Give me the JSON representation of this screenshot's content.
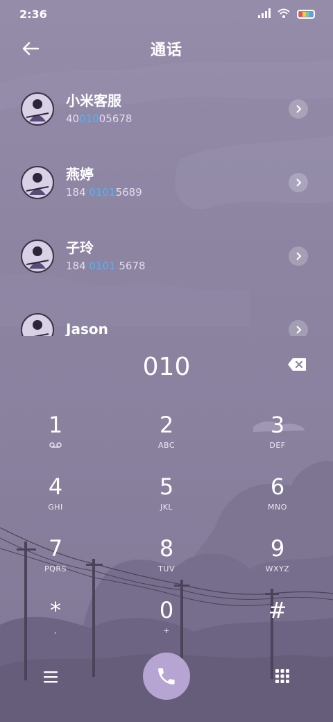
{
  "status_bar": {
    "time": "2:36",
    "icons": [
      "signal-icon",
      "wifi-icon",
      "battery-icon"
    ]
  },
  "header": {
    "title": "通话",
    "back_icon": "arrow-left-icon"
  },
  "contacts": [
    {
      "name": "小米客服",
      "number_pre": "40",
      "number_hl": "010",
      "number_post": "05678"
    },
    {
      "name": "燕婷",
      "number_pre": "184 ",
      "number_hl": "0101",
      "number_post": "5689"
    },
    {
      "name": "子玲",
      "number_pre": "184 ",
      "number_hl": "0101",
      "number_post": " 5678"
    },
    {
      "name": "Jason",
      "number_pre": "",
      "number_hl": "",
      "number_post": ""
    }
  ],
  "dialer": {
    "input": "010"
  },
  "keypad": [
    {
      "digit": "1",
      "letters": ""
    },
    {
      "digit": "2",
      "letters": "ABC"
    },
    {
      "digit": "3",
      "letters": "DEF"
    },
    {
      "digit": "4",
      "letters": "GHI"
    },
    {
      "digit": "5",
      "letters": "JKL"
    },
    {
      "digit": "6",
      "letters": "MNO"
    },
    {
      "digit": "7",
      "letters": "PQRS"
    },
    {
      "digit": "8",
      "letters": "TUV"
    },
    {
      "digit": "9",
      "letters": "WXYZ"
    },
    {
      "digit": "*",
      "letters": ","
    },
    {
      "digit": "0",
      "letters": "+"
    },
    {
      "digit": "#",
      "letters": ""
    }
  ],
  "colors": {
    "highlight": "#4fb3ff",
    "call_button": "#b6a5d2",
    "background": "#8f86a3"
  }
}
